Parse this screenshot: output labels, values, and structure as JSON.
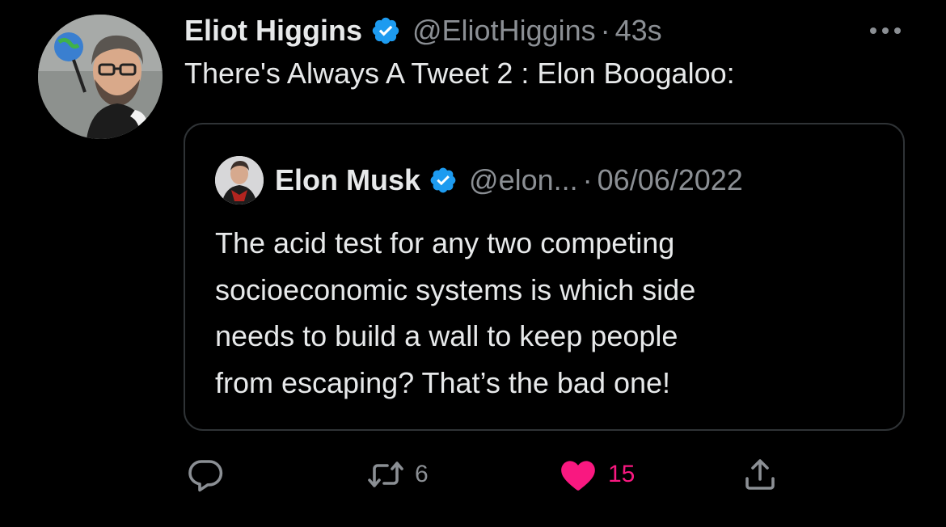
{
  "tweet": {
    "author": {
      "display_name": "Eliot Higgins",
      "handle": "@EliotHiggins",
      "verified": true
    },
    "separator": "·",
    "time": "43s",
    "text": "There's Always A Tweet 2 : Elon Boogaloo:",
    "more_icon": "more-icon"
  },
  "quoted_tweet": {
    "author": {
      "display_name": "Elon Musk",
      "handle": "@elon...",
      "verified": true
    },
    "separator": "·",
    "date": "06/06/2022",
    "text_lines": [
      "The acid test for any two competing",
      "socioeconomic systems is which side",
      "needs to build a wall to keep people",
      "from escaping? That’s the bad one!"
    ]
  },
  "actions": {
    "reply": {
      "icon": "reply-icon",
      "count": ""
    },
    "retweet": {
      "icon": "retweet-icon",
      "count": "6"
    },
    "like": {
      "icon": "heart-icon",
      "count": "15",
      "liked": true
    },
    "share": {
      "icon": "share-icon"
    }
  },
  "colors": {
    "background": "#000000",
    "text": "#e7e9ea",
    "secondary": "#8b8f94",
    "border": "#2f3336",
    "verified": "#1d9bf0",
    "like": "#f91880"
  }
}
